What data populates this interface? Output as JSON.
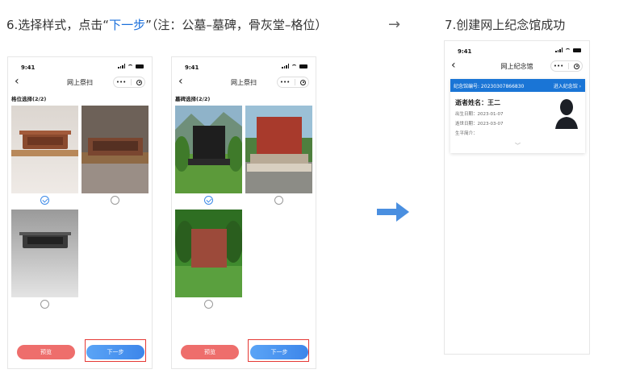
{
  "step6": {
    "prefix": "6.选择样式，点击“",
    "highlight": "下一步",
    "suffix": "”（注：公墓–墓碑，骨灰堂–格位）"
  },
  "arrow_small": "→",
  "step7": {
    "title": "7.创建网上纪念馆成功"
  },
  "phone_common": {
    "time": "9:41",
    "capsule_dots": "•••"
  },
  "phone1": {
    "nav_title": "网上祭扫",
    "section_label": "格位选择(2/2)",
    "preview_label": "预览",
    "next_label": "下一步"
  },
  "phone2": {
    "nav_title": "网上祭扫",
    "section_label": "墓碑选择(2/2)",
    "preview_label": "预览",
    "next_label": "下一步"
  },
  "phone3": {
    "nav_title": "网上纪念馆",
    "memorial_no_label": "纪念馆编号: 20230307866830",
    "enter_label": "进入纪念馆 ›",
    "deceased_name": "逝者姓名：王二",
    "birth_date": "出生日期：2023-01-07",
    "death_date": "逝世日期：2023-03-07",
    "bio_label": "生平简介：",
    "expand_icon": "﹀"
  },
  "colors": {
    "accent": "#1a75d6",
    "preview": "#ee6e6c",
    "next": "#3d86ea",
    "highlight_box": "#e53935"
  }
}
